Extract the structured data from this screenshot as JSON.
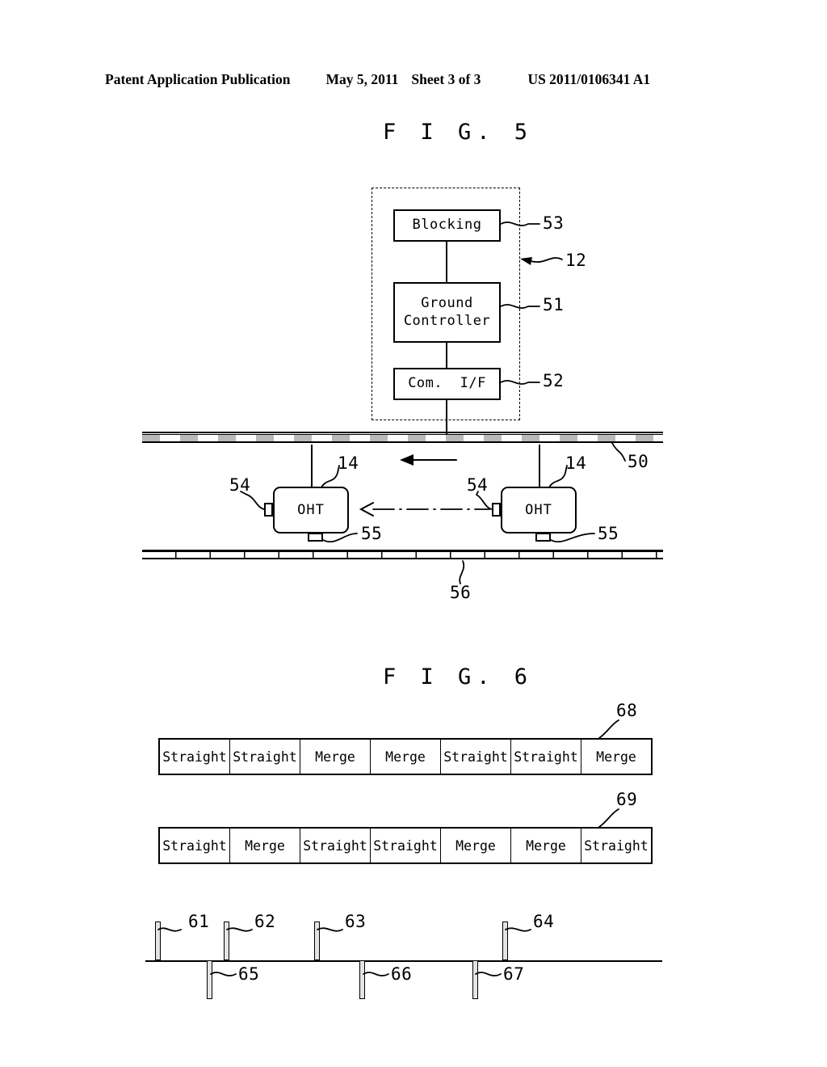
{
  "header": {
    "publication": "Patent Application Publication",
    "date": "May 5, 2011",
    "sheet": "Sheet 3 of 3",
    "number": "US 2011/0106341 A1"
  },
  "fig5": {
    "title": "F I G.  5",
    "boxes": {
      "blocking": "Blocking",
      "ground_controller": "Ground\nController",
      "com_if": "Com.  I/F",
      "oht_left": "OHT",
      "oht_right": "OHT"
    },
    "refs": {
      "r53": "53",
      "r12": "12",
      "r51": "51",
      "r52": "52",
      "r50": "50",
      "r14_left": "14",
      "r14_right": "14",
      "r54_left": "54",
      "r54_right": "54",
      "r55_left": "55",
      "r55_right": "55",
      "r56": "56"
    }
  },
  "fig6": {
    "title": "F I G.  6",
    "refs": {
      "r68": "68",
      "r69": "69",
      "r61": "61",
      "r62": "62",
      "r63": "63",
      "r64": "64",
      "r65": "65",
      "r66": "66",
      "r67": "67"
    },
    "table_68": [
      "Straight",
      "Straight",
      "Merge",
      "Merge",
      "Straight",
      "Straight",
      "Merge"
    ],
    "table_69": [
      "Straight",
      "Merge",
      "Straight",
      "Straight",
      "Merge",
      "Merge",
      "Straight"
    ]
  },
  "colors": {
    "ink": "#000000",
    "paper": "#ffffff",
    "rail_hatch": "#b9b9b9"
  }
}
